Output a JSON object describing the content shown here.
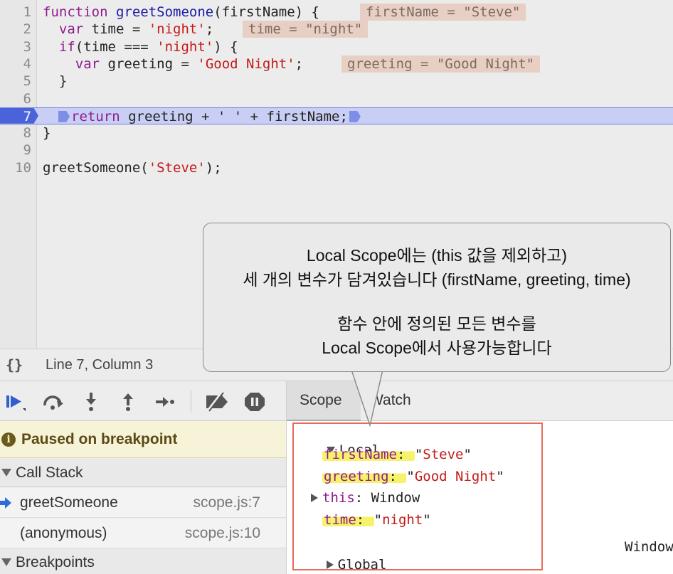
{
  "editor": {
    "lines": [
      {
        "num": "1",
        "parts": [
          [
            "kw",
            "function"
          ],
          [
            "t",
            " "
          ],
          [
            "fn",
            "greetSomeone"
          ],
          [
            "t",
            "(firstName) {"
          ]
        ],
        "inline": "firstName = \"Steve\""
      },
      {
        "num": "2",
        "parts": [
          [
            "t",
            "  "
          ],
          [
            "kw",
            "var"
          ],
          [
            "t",
            " time = "
          ],
          [
            "str",
            "'night'"
          ],
          [
            "t",
            ";"
          ]
        ],
        "inline": "time = \"night\""
      },
      {
        "num": "3",
        "parts": [
          [
            "t",
            "  "
          ],
          [
            "kw",
            "if"
          ],
          [
            "t",
            "(time === "
          ],
          [
            "str",
            "'night'"
          ],
          [
            "t",
            ") {"
          ]
        ],
        "inline": ""
      },
      {
        "num": "4",
        "parts": [
          [
            "t",
            "    "
          ],
          [
            "kw",
            "var"
          ],
          [
            "t",
            " greeting = "
          ],
          [
            "str",
            "'Good Night'"
          ],
          [
            "t",
            ";"
          ]
        ],
        "inline": "greeting = \"Good Night\""
      },
      {
        "num": "5",
        "parts": [
          [
            "t",
            "  }"
          ]
        ],
        "inline": ""
      },
      {
        "num": "6",
        "parts": [],
        "inline": ""
      },
      {
        "num": "7",
        "parts": [],
        "inline": ""
      },
      {
        "num": "8",
        "parts": [
          [
            "t",
            "}"
          ]
        ],
        "inline": ""
      },
      {
        "num": "9",
        "parts": [],
        "inline": ""
      },
      {
        "num": "10",
        "parts": [
          [
            "t",
            "greetSomeone("
          ],
          [
            "str",
            "'Steve'"
          ],
          [
            "t",
            ");"
          ]
        ],
        "inline": ""
      }
    ],
    "line7": {
      "keyword": "return",
      "rest": " greeting + ' ' + firstName;"
    }
  },
  "status": {
    "braces": "{}",
    "cursor": "Line 7, Column 3"
  },
  "toolbar": {
    "buttons": [
      "resume-icon",
      "step-over-icon",
      "step-into-icon",
      "step-out-icon",
      "step-icon",
      "deactivate-breakpoints-icon",
      "pause-on-exceptions-icon"
    ]
  },
  "debugger": {
    "paused_text": "Paused on breakpoint",
    "info_glyph": "i",
    "call_stack_label": "Call Stack",
    "frames": [
      {
        "name": "greetSomeone",
        "location": "scope.js:7"
      },
      {
        "name": "(anonymous)",
        "location": "scope.js:10"
      }
    ],
    "breakpoints_label": "Breakpoints"
  },
  "sidebar": {
    "tab_scope": "Scope",
    "tab_watch": "Watch"
  },
  "scope": {
    "local_label": "Local",
    "props": [
      {
        "name": "firstName",
        "sep": ": ",
        "value": "\"Steve\"",
        "highlight": true,
        "kind": "str"
      },
      {
        "name": "greeting",
        "sep": ": ",
        "value": "\"Good Night\"",
        "highlight": true,
        "kind": "str"
      },
      {
        "name": "this",
        "sep": ": ",
        "value": "Window",
        "highlight": false,
        "kind": "obj"
      },
      {
        "name": "time",
        "sep": ": ",
        "value": "\"night\"",
        "highlight": true,
        "kind": "str"
      }
    ],
    "global_label": "Global",
    "global_value": "Window"
  },
  "callout": {
    "line1": "Local Scope에는 (this 값을 제외하고)",
    "line2": "세 개의 변수가 담겨있습니다 (firstName, greeting, time)",
    "line3": "함수 안에 정의된 모든 변수를",
    "line4": "Local Scope에서 사용가능합니다"
  },
  "colors": {
    "keyword": "#8e1c8e",
    "string": "#c41a16",
    "breakpoint_line": "#c9cff4",
    "scope_highlight_border": "#e86a5a",
    "marker_yellow": "#f6f26a"
  }
}
